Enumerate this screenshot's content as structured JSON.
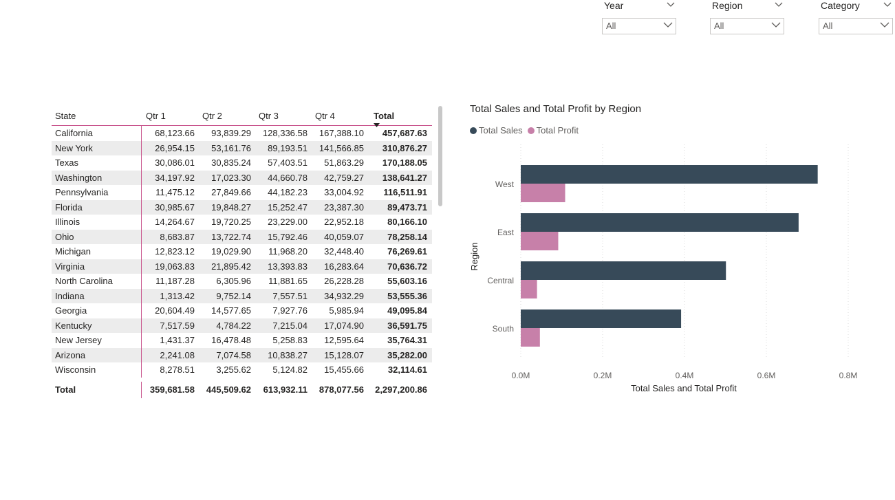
{
  "slicers": [
    {
      "title": "Year",
      "value": "All"
    },
    {
      "title": "Region",
      "value": "All"
    },
    {
      "title": "Category",
      "value": "All"
    }
  ],
  "table": {
    "headers": [
      "State",
      "Qtr 1",
      "Qtr 2",
      "Qtr 3",
      "Qtr 4",
      "Total"
    ],
    "rows": [
      [
        "California",
        "68,123.66",
        "93,839.29",
        "128,336.58",
        "167,388.10",
        "457,687.63"
      ],
      [
        "New York",
        "26,954.15",
        "53,161.76",
        "89,193.51",
        "141,566.85",
        "310,876.27"
      ],
      [
        "Texas",
        "30,086.01",
        "30,835.24",
        "57,403.51",
        "51,863.29",
        "170,188.05"
      ],
      [
        "Washington",
        "34,197.92",
        "17,023.30",
        "44,660.78",
        "42,759.27",
        "138,641.27"
      ],
      [
        "Pennsylvania",
        "11,475.12",
        "27,849.66",
        "44,182.23",
        "33,004.92",
        "116,511.91"
      ],
      [
        "Florida",
        "30,985.67",
        "19,848.27",
        "15,252.47",
        "23,387.30",
        "89,473.71"
      ],
      [
        "Illinois",
        "14,264.67",
        "19,720.25",
        "23,229.00",
        "22,952.18",
        "80,166.10"
      ],
      [
        "Ohio",
        "8,683.87",
        "13,722.74",
        "15,792.46",
        "40,059.07",
        "78,258.14"
      ],
      [
        "Michigan",
        "12,823.12",
        "19,029.90",
        "11,968.20",
        "32,448.40",
        "76,269.61"
      ],
      [
        "Virginia",
        "19,063.83",
        "21,895.42",
        "13,393.83",
        "16,283.64",
        "70,636.72"
      ],
      [
        "North Carolina",
        "11,187.28",
        "6,305.96",
        "11,881.65",
        "26,228.28",
        "55,603.16"
      ],
      [
        "Indiana",
        "1,313.42",
        "9,752.14",
        "7,557.51",
        "34,932.29",
        "53,555.36"
      ],
      [
        "Georgia",
        "20,604.49",
        "14,577.65",
        "7,927.76",
        "5,985.94",
        "49,095.84"
      ],
      [
        "Kentucky",
        "7,517.59",
        "4,784.22",
        "7,215.04",
        "17,074.90",
        "36,591.75"
      ],
      [
        "New Jersey",
        "1,431.37",
        "16,478.48",
        "5,258.83",
        "12,595.64",
        "35,764.31"
      ],
      [
        "Arizona",
        "2,241.08",
        "7,074.58",
        "10,838.27",
        "15,128.07",
        "35,282.00"
      ],
      [
        "Wisconsin",
        "8,278.51",
        "3,255.62",
        "5,124.82",
        "15,455.66",
        "32,114.61"
      ]
    ],
    "total": [
      "Total",
      "359,681.58",
      "445,509.62",
      "613,932.11",
      "878,077.56",
      "2,297,200.86"
    ]
  },
  "chart_data": {
    "type": "bar",
    "orientation": "horizontal",
    "title": "Total Sales and Total Profit by Region",
    "xlabel": "Total Sales and Total Profit",
    "ylabel": "Region",
    "categories": [
      "West",
      "East",
      "Central",
      "South"
    ],
    "series": [
      {
        "name": "Total Sales",
        "color": "#374a59",
        "values": [
          725458,
          678781,
          501240,
          391722
        ]
      },
      {
        "name": "Total Profit",
        "color": "#c780a9",
        "values": [
          108418,
          91523,
          39706,
          46749
        ]
      }
    ],
    "xlim": [
      0,
      800000
    ],
    "xticks": [
      "0.0M",
      "0.2M",
      "0.4M",
      "0.6M",
      "0.8M"
    ],
    "grid": "vertical dotted",
    "legend_position": "top-left"
  }
}
